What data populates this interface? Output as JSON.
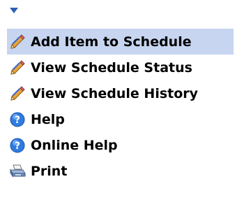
{
  "menu": {
    "toggle_icon": "triangle-down-icon",
    "items": [
      {
        "label": "Add Item to Schedule",
        "icon": "pencil-icon",
        "highlighted": true
      },
      {
        "label": "View Schedule Status",
        "icon": "pencil-icon",
        "highlighted": false
      },
      {
        "label": "View Schedule History",
        "icon": "pencil-icon",
        "highlighted": false
      },
      {
        "label": "Help",
        "icon": "help-icon",
        "highlighted": false
      },
      {
        "label": "Online Help",
        "icon": "help-icon",
        "highlighted": false
      },
      {
        "label": "Print",
        "icon": "printer-icon",
        "highlighted": false
      }
    ]
  },
  "colors": {
    "highlight": "#c7d5f0",
    "toggle_arrow": "#2d5fb6",
    "help_blue": "#2f7be0"
  }
}
